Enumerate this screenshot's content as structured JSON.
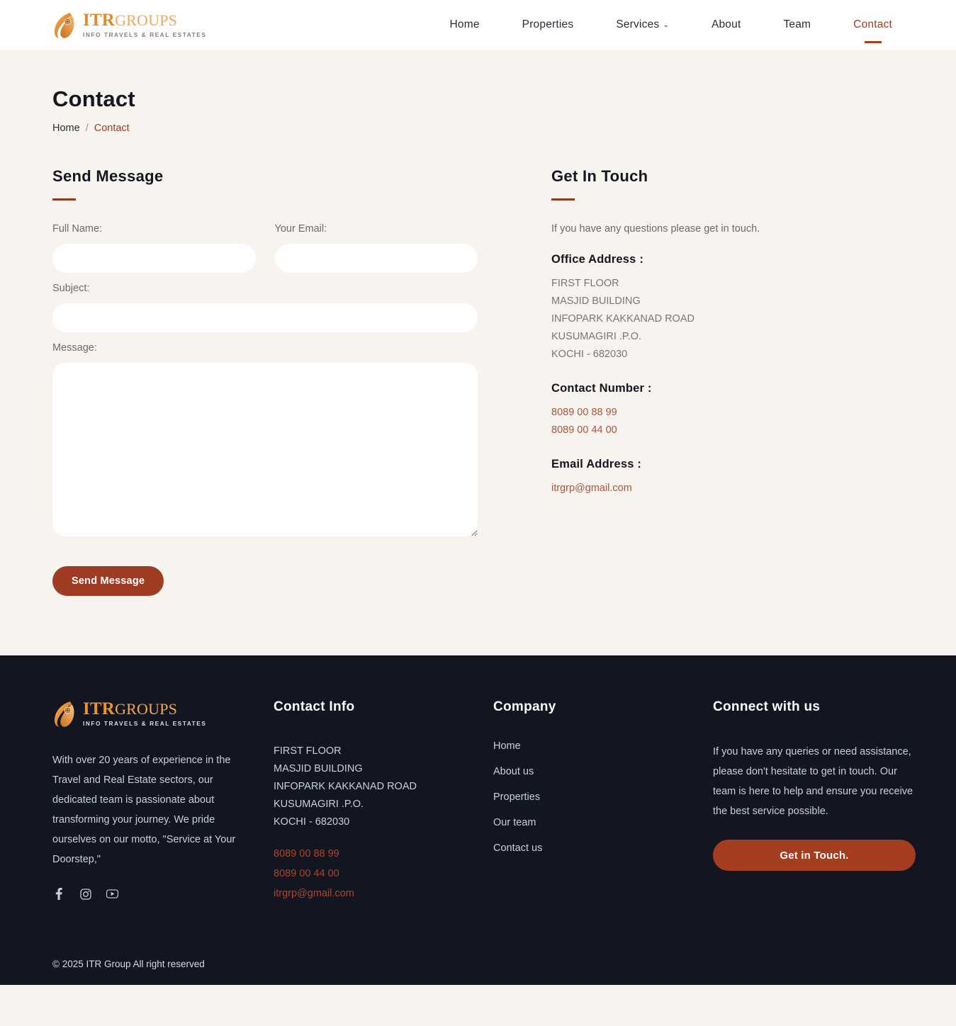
{
  "brand": {
    "name_bold": "ITR",
    "name_light": "GROUPS",
    "tagline": "INFO TRAVELS & REAL ESTATES"
  },
  "header": {
    "nav": [
      {
        "label": "Home",
        "active": false,
        "caret": false
      },
      {
        "label": "Properties",
        "active": false,
        "caret": false
      },
      {
        "label": "Services",
        "active": false,
        "caret": true
      },
      {
        "label": "About",
        "active": false,
        "caret": false
      },
      {
        "label": "Team",
        "active": false,
        "caret": false
      },
      {
        "label": "Contact",
        "active": true,
        "caret": false
      }
    ],
    "caret_glyph": "⌄"
  },
  "hero": {
    "title": "Contact",
    "breadcrumb_home": "Home",
    "breadcrumb_sep": "/",
    "breadcrumb_current": "Contact"
  },
  "form": {
    "section_title": "Send Message",
    "full_name_label": "Full Name:",
    "full_name_value": "",
    "full_name_placeholder": "",
    "email_label": "Your Email:",
    "email_value": "",
    "email_placeholder": "",
    "subject_label": "Subject:",
    "subject_value": "",
    "subject_placeholder": "",
    "message_label": "Message:",
    "message_value": "",
    "message_placeholder": "",
    "submit_label": "Send Message"
  },
  "get_in_touch": {
    "section_title": "Get In Touch",
    "lead": "If you have any questions please get in touch.",
    "office_address_heading": "Office Address :",
    "address_lines": [
      "FIRST FLOOR",
      "MASJID BUILDING",
      "INFOPARK KAKKANAD ROAD",
      "KUSUMAGIRI .P.O.",
      "KOCHI - 682030"
    ],
    "contact_number_heading": "Contact Number :",
    "phones": [
      "8089 00 88 99",
      "8089 00 44 00"
    ],
    "email_heading": "Email Address :",
    "email": "itrgrp@gmail.com"
  },
  "footer": {
    "about": "With over 20 years of experience in the Travel and Real Estate sectors, our dedicated team is passionate about transforming your journey. We pride ourselves on our motto, \"Service at Your Doorstep,\"",
    "socials": [
      {
        "name": "facebook-icon"
      },
      {
        "name": "instagram-icon"
      },
      {
        "name": "youtube-icon"
      }
    ],
    "contact_info": {
      "title": "Contact Info",
      "address_lines": [
        "FIRST FLOOR",
        "MASJID BUILDING",
        "INFOPARK KAKKANAD ROAD",
        "KUSUMAGIRI .P.O.",
        "KOCHI - 682030"
      ],
      "phones": [
        "8089 00 88 99",
        "8089 00 44 00"
      ],
      "email": "itrgrp@gmail.com"
    },
    "company": {
      "title": "Company",
      "links": [
        "Home",
        "About us",
        "Properties",
        "Our team",
        "Contact us"
      ]
    },
    "connect": {
      "title": "Connect with us",
      "text": "If you have any queries or need assistance, please don't hesitate to get in touch. Our team is here to help and ensure you receive the best service possible.",
      "cta_label": "Get in Touch."
    },
    "copyright": "© 2025 ITR Group All right reserved"
  },
  "colors": {
    "accent": "#A23E22",
    "button": "#9E3B22",
    "brand_orange": "#E08A2E",
    "brand_orange_light": "#F0A95C",
    "footer_bg": "#121620",
    "page_bg": "#F7F3EE",
    "phone_link": "#B2432A"
  }
}
